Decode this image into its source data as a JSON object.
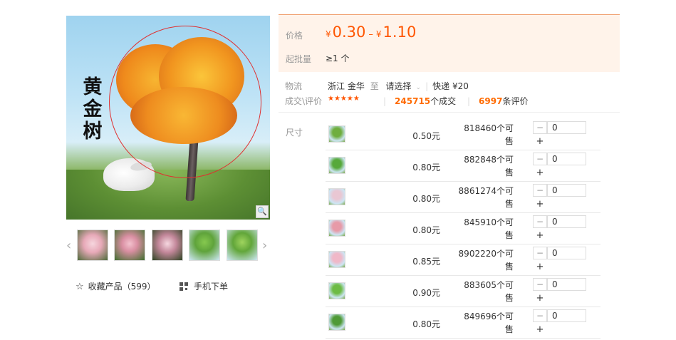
{
  "product": {
    "image_caption": "黄金树"
  },
  "actions": {
    "favorite_label": "收藏产品（599）",
    "mobile_order_label": "手机下单"
  },
  "price": {
    "label": "价格",
    "currency": "¥",
    "min": "0.30",
    "max": "1.10",
    "range_sep": "–",
    "moq_label": "起批量",
    "moq_value": "≥1 个"
  },
  "logistics": {
    "label": "物流",
    "origin_province": "浙江",
    "origin_city": "金华",
    "to": "至",
    "destination_placeholder": "请选择",
    "shipping": "快递 ¥20"
  },
  "deals": {
    "label": "成交\\评价",
    "rating_stars": "★★★★★",
    "transactions_count": "245715",
    "transactions_unit": "个成交",
    "reviews_count": "6997",
    "reviews_unit": "条评价"
  },
  "sku": {
    "label": "尺寸",
    "rows": [
      {
        "price": "0.50元",
        "stock": "818460个可售",
        "qty": "0",
        "thumb_color": "#6fae3e"
      },
      {
        "price": "0.80元",
        "stock": "882848个可售",
        "qty": "0",
        "thumb_color": "#57a93a"
      },
      {
        "price": "0.80元",
        "stock": "8861274个可售",
        "qty": "0",
        "thumb_color": "#e9c7d3"
      },
      {
        "price": "0.80元",
        "stock": "845910个可售",
        "qty": "0",
        "thumb_color": "#e79aa8"
      },
      {
        "price": "0.85元",
        "stock": "8902220个可售",
        "qty": "0",
        "thumb_color": "#f0b8c8"
      },
      {
        "price": "0.90元",
        "stock": "883605个可售",
        "qty": "0",
        "thumb_color": "#6dbb45"
      },
      {
        "price": "0.80元",
        "stock": "849696个可售",
        "qty": "0",
        "thumb_color": "#4f9a36"
      }
    ],
    "minus": "−",
    "plus": "+"
  },
  "colors": {
    "accent": "#ff5500",
    "price_box_bg": "#fff3ea"
  }
}
